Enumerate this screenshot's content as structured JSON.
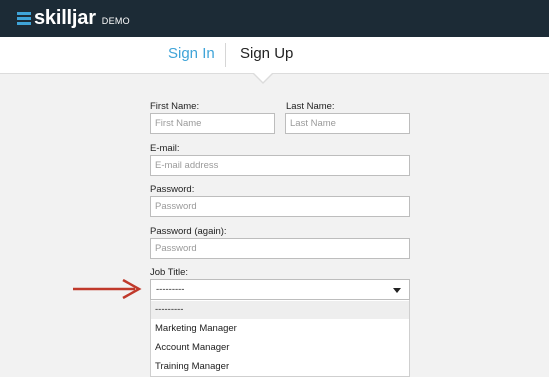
{
  "header": {
    "brand": "skilljar",
    "badge": "DEMO",
    "bg_color": "#1c2b36",
    "accent_color": "#3fa4d8"
  },
  "tabs": [
    {
      "label": "Sign In",
      "active": false
    },
    {
      "label": "Sign Up",
      "active": true
    }
  ],
  "form": {
    "first_name": {
      "label": "First Name:",
      "placeholder": "First Name",
      "value": ""
    },
    "last_name": {
      "label": "Last Name:",
      "placeholder": "Last Name",
      "value": ""
    },
    "email": {
      "label": "E-mail:",
      "placeholder": "E-mail address",
      "value": ""
    },
    "password": {
      "label": "Password:",
      "placeholder": "Password",
      "value": ""
    },
    "password_again": {
      "label": "Password (again):",
      "placeholder": "Password",
      "value": ""
    },
    "job_title": {
      "label": "Job Title:",
      "selected": "---------",
      "options": [
        "---------",
        "Marketing Manager",
        "Account Manager",
        "Training Manager"
      ]
    }
  },
  "annotation": {
    "icon": "right-arrow-icon",
    "color": "#c0392b"
  }
}
